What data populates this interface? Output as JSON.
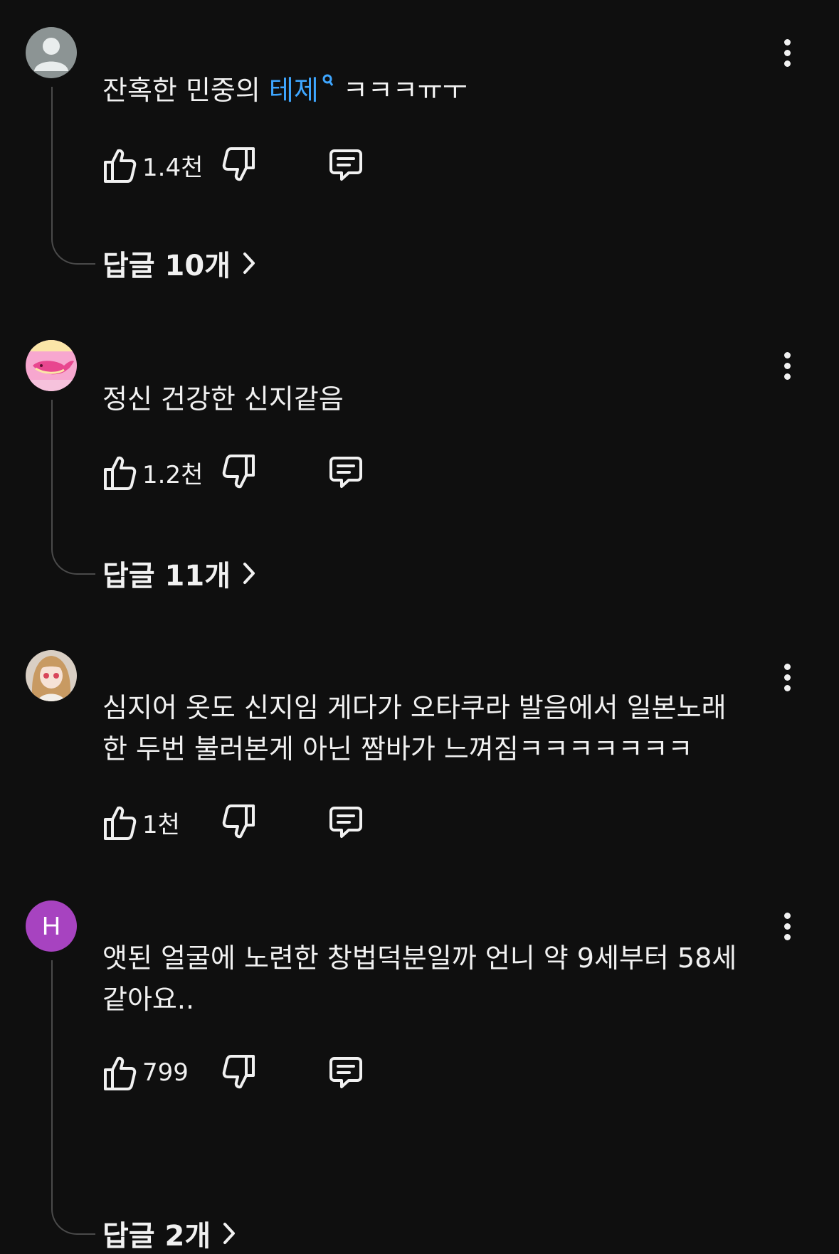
{
  "comments": [
    {
      "text_before": "잔혹한 민중의 ",
      "hashtag": "테제",
      "text_after": " ㅋㅋㅋㅠㅜ",
      "likes": "1.4천",
      "replies": "답글 10개",
      "avatar": "default-person-icon"
    },
    {
      "text": "정신 건강한 신지같음",
      "likes": "1.2천",
      "replies": "답글 11개",
      "avatar": "pink-whale-icon"
    },
    {
      "text_line1": "심지어 옷도 신지임 게다가 오타쿠라 발음에서 일본노래",
      "text_line2": "한 두번 불러본게 아닌 짬바가 느껴짐ㅋㅋㅋㅋㅋㅋㅋ",
      "likes": "1천",
      "avatar": "anime-girl-icon"
    },
    {
      "text_line1": "앳된 얼굴에 노련한 창법덕분일까 언니 약 9세부터 58세",
      "text_line2": "같아요..",
      "likes": "799",
      "replies": "답글 2개",
      "avatar_letter": "H",
      "avatar_color": "#a743c0"
    }
  ],
  "colors": {
    "background": "#0f0f0f",
    "text": "#f1f1f1",
    "hashtag": "#3ea6ff",
    "thread_line": "#4a4a4a"
  }
}
